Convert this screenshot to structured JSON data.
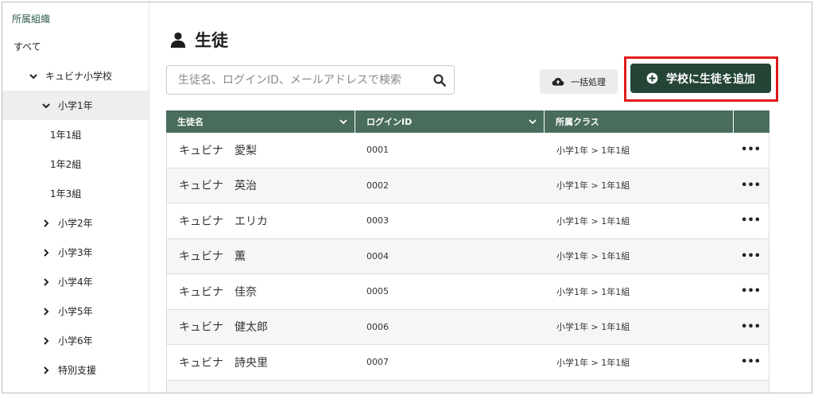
{
  "sidebar": {
    "title": "所属組織",
    "items": [
      {
        "label": "すべて",
        "level": 0,
        "expand": "none",
        "active": false
      },
      {
        "label": "キュビナ小学校",
        "level": 1,
        "expand": "expanded",
        "active": false
      },
      {
        "label": "小学1年",
        "level": 2,
        "expand": "expanded",
        "active": true
      },
      {
        "label": "1年1組",
        "level": 3,
        "expand": "none",
        "active": false
      },
      {
        "label": "1年2組",
        "level": 3,
        "expand": "none",
        "active": false
      },
      {
        "label": "1年3組",
        "level": 3,
        "expand": "none",
        "active": false
      },
      {
        "label": "小学2年",
        "level": 2,
        "expand": "collapsed",
        "active": false
      },
      {
        "label": "小学3年",
        "level": 2,
        "expand": "collapsed",
        "active": false
      },
      {
        "label": "小学4年",
        "level": 2,
        "expand": "collapsed",
        "active": false
      },
      {
        "label": "小学5年",
        "level": 2,
        "expand": "collapsed",
        "active": false
      },
      {
        "label": "小学6年",
        "level": 2,
        "expand": "collapsed",
        "active": false
      },
      {
        "label": "特別支援",
        "level": 2,
        "expand": "collapsed",
        "active": false
      }
    ]
  },
  "header": {
    "title": "生徒",
    "icon": "user-icon"
  },
  "search": {
    "placeholder": "生徒名、ログインID、メールアドレスで検索",
    "value": ""
  },
  "toolbar": {
    "bulk_label": "一括処理",
    "bulk_icon": "cloud-upload-icon",
    "add_label": "学校に生徒を追加",
    "add_icon": "plus-circle-icon",
    "highlight_color": "#e01b1b",
    "accent_color": "#244436"
  },
  "table": {
    "columns": [
      {
        "label": "生徒名",
        "sortable": true
      },
      {
        "label": "ログインID",
        "sortable": true
      },
      {
        "label": "所属クラス",
        "sortable": false
      },
      {
        "label": "",
        "sortable": false
      }
    ],
    "header_color": "#496c5c",
    "rows": [
      {
        "name": "キュビナ　愛梨",
        "login_id": "0001",
        "class": "小学1年 > 1年1組",
        "more": "•••"
      },
      {
        "name": "キュビナ　英治",
        "login_id": "0002",
        "class": "小学1年 > 1年1組",
        "more": "•••"
      },
      {
        "name": "キュビナ　エリカ",
        "login_id": "0003",
        "class": "小学1年 > 1年1組",
        "more": "•••"
      },
      {
        "name": "キュビナ　薫",
        "login_id": "0004",
        "class": "小学1年 > 1年1組",
        "more": "•••"
      },
      {
        "name": "キュビナ　佳奈",
        "login_id": "0005",
        "class": "小学1年 > 1年1組",
        "more": "•••"
      },
      {
        "name": "キュビナ　健太郎",
        "login_id": "0006",
        "class": "小学1年 > 1年1組",
        "more": "•••"
      },
      {
        "name": "キュビナ　詩央里",
        "login_id": "0007",
        "class": "小学1年 > 1年1組",
        "more": "•••"
      }
    ]
  }
}
